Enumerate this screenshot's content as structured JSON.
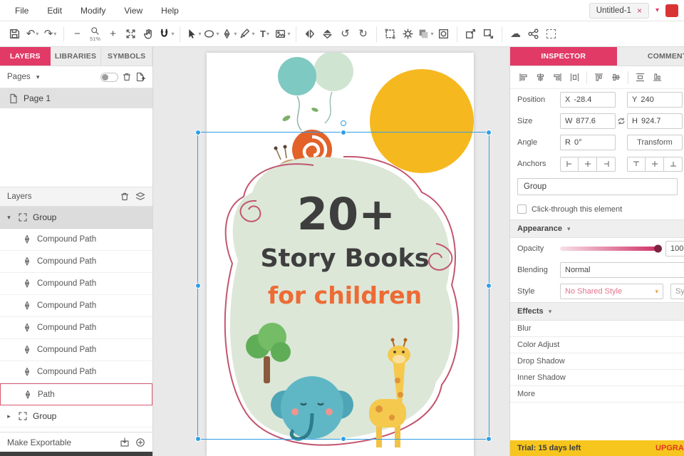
{
  "colors": {
    "accent": "#e23a67",
    "selection_blue": "#2f9ee8",
    "trial_yellow": "#f6c51e",
    "upgrade_red": "#e2361f"
  },
  "glyphs": {
    "caret_down": "▾",
    "caret_right": "▸"
  },
  "menubar": {
    "items": [
      "File",
      "Edit",
      "Modify",
      "View",
      "Help"
    ],
    "document_tab": {
      "label": "Untitled-1",
      "close": "×"
    }
  },
  "toolbar": {
    "zoom_level": "51%",
    "glyphs": {
      "undo": "↶",
      "redo": "↷",
      "minus": "−",
      "plus": "+",
      "text_tool": "T",
      "rotate_ccw": "↺",
      "rotate_cw": "↻",
      "cloud": "☁"
    }
  },
  "left_panel": {
    "tabs": [
      {
        "label": "LAYERS"
      },
      {
        "label": "LIBRARIES"
      },
      {
        "label": "SYMBOLS"
      }
    ],
    "pages": {
      "header": "Pages",
      "items": [
        {
          "label": "Page 1"
        }
      ]
    },
    "layers": {
      "header": "Layers",
      "items": [
        {
          "label": "Group",
          "caret": "▾"
        },
        {
          "label": "Compound Path"
        },
        {
          "label": "Compound Path"
        },
        {
          "label": "Compound Path"
        },
        {
          "label": "Compound Path"
        },
        {
          "label": "Compound Path"
        },
        {
          "label": "Compound Path"
        },
        {
          "label": "Compound Path"
        },
        {
          "label": "Path"
        },
        {
          "label": "Group",
          "caret": "▸"
        }
      ]
    },
    "make_exportable": "Make Exportable"
  },
  "canvas": {
    "artwork": {
      "headline": "20+",
      "title": "Story Books",
      "subtitle": "for children"
    }
  },
  "inspector": {
    "tabs": [
      {
        "label": "INSPECTOR"
      },
      {
        "label": "COMMENTS"
      }
    ],
    "position": {
      "label": "Position",
      "x_label": "X",
      "x": "-28.4",
      "y_label": "Y",
      "y": "240"
    },
    "size": {
      "label": "Size",
      "w_label": "W",
      "w": "877.6",
      "h_label": "H",
      "h": "924.7"
    },
    "angle": {
      "label": "Angle",
      "r_label": "R",
      "r": "0°",
      "transform": "Transform"
    },
    "anchors": {
      "label": "Anchors"
    },
    "element_type": "Group",
    "clickthrough": "Click-through this element",
    "appearance": {
      "header": "Appearance",
      "opacity_label": "Opacity",
      "opacity_value": "100",
      "blending_label": "Blending",
      "blending_value": "Normal",
      "style_label": "Style",
      "style_value": "No Shared Style",
      "style_secondary": "Symbol"
    },
    "effects": {
      "header": "Effects",
      "items": [
        "Blur",
        "Color Adjust",
        "Drop Shadow",
        "Inner Shadow",
        "More"
      ]
    },
    "trial": {
      "text": "Trial: 15 days left",
      "upgrade": "UPGRADE NOW"
    }
  }
}
